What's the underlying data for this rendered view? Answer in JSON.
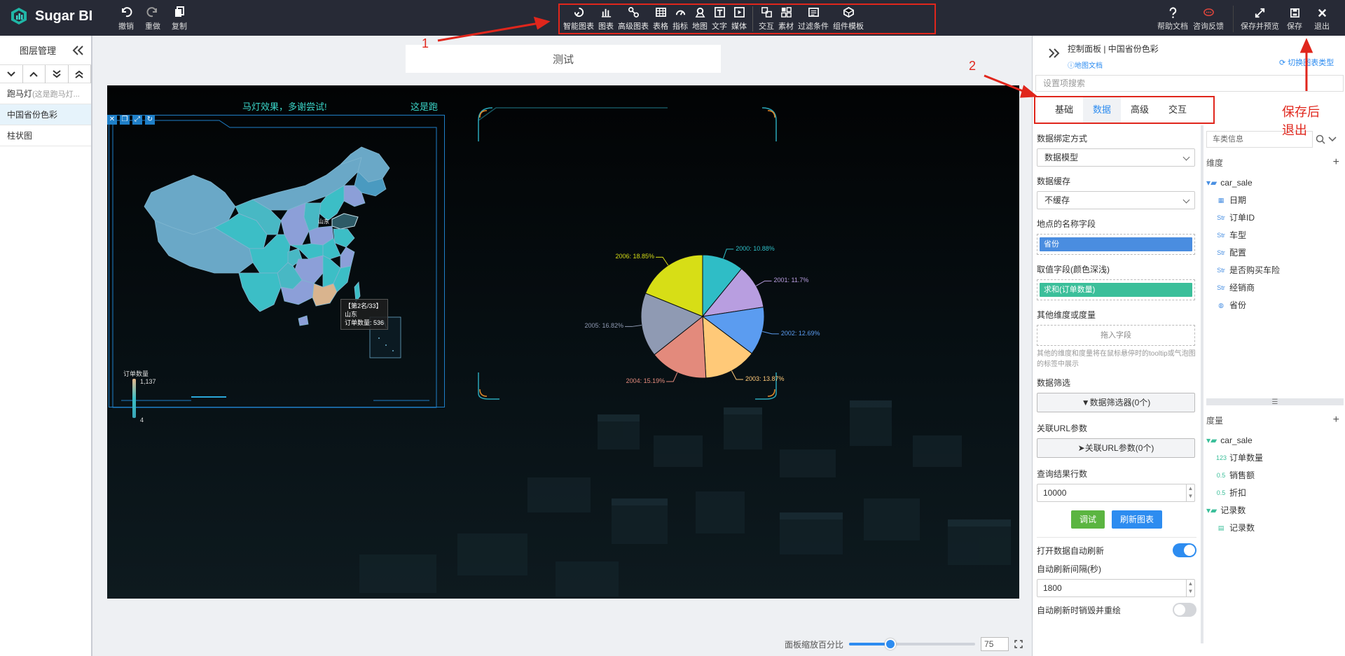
{
  "app": {
    "name": "Sugar BI"
  },
  "toolbar_left": [
    {
      "label": "撤销",
      "icon": "undo-icon"
    },
    {
      "label": "重做",
      "icon": "redo-icon"
    },
    {
      "label": "复制",
      "icon": "copy-icon"
    }
  ],
  "component_tools": [
    {
      "label": "智能图表",
      "icon": "smart-chart-icon"
    },
    {
      "label": "图表",
      "icon": "bar-chart-icon"
    },
    {
      "label": "高级图表",
      "icon": "advanced-chart-icon"
    },
    {
      "label": "表格",
      "icon": "table-icon"
    },
    {
      "label": "指标",
      "icon": "gauge-icon"
    },
    {
      "label": "地图",
      "icon": "map-pin-icon"
    },
    {
      "label": "文字",
      "icon": "text-icon"
    },
    {
      "label": "媒体",
      "icon": "media-icon"
    },
    {
      "label": "交互",
      "icon": "interaction-icon"
    },
    {
      "label": "素材",
      "icon": "material-icon"
    },
    {
      "label": "过滤条件",
      "icon": "filter-icon"
    },
    {
      "label": "组件模板",
      "icon": "template-icon"
    }
  ],
  "toolbar_right": [
    {
      "label": "帮助文档",
      "icon": "help-icon"
    },
    {
      "label": "咨询反馈",
      "icon": "feedback-icon"
    },
    {
      "label": "保存并预览",
      "icon": "expand-icon"
    },
    {
      "label": "保存",
      "icon": "save-icon"
    },
    {
      "label": "退出",
      "icon": "close-icon"
    }
  ],
  "layer_panel": {
    "title": "图层管理",
    "layers": [
      {
        "label": "跑马灯",
        "hint": "(这是跑马灯..."
      },
      {
        "label": "中国省份色彩",
        "hint": ""
      },
      {
        "label": "柱状图",
        "hint": ""
      }
    ]
  },
  "canvas": {
    "title": "测试",
    "marquee_1": "马灯效果，多谢尝试!",
    "marquee_2": "这是跑"
  },
  "map": {
    "tooltip": [
      "【第2名/33】",
      "山东",
      "订单数量: 536"
    ],
    "province_label": "山东",
    "legend_title": "订单数量",
    "legend_max": "1,137",
    "legend_min": "4"
  },
  "chart_data": {
    "type": "pie",
    "categories": [
      "2000",
      "2001",
      "2002",
      "2003",
      "2004",
      "2005",
      "2006"
    ],
    "values": [
      10.88,
      11.7,
      12.69,
      13.87,
      15.19,
      16.82,
      18.85
    ],
    "labels": [
      "2000: 10.88%",
      "2001: 11.7%",
      "2002: 12.69%",
      "2003: 13.87%",
      "2004: 15.19%",
      "2005: 16.82%",
      "2006: 18.85%"
    ],
    "colors": [
      "#2fbdc6",
      "#b89ee0",
      "#5b9cf0",
      "#ffc978",
      "#e38a7c",
      "#8f9ab3",
      "#d7de16"
    ]
  },
  "zoom": {
    "label": "面板缩放百分比",
    "value": "75",
    "fraction": 0.33
  },
  "right_panel": {
    "title": "控制面板 | 中国省份色彩",
    "doc_link": "地图文档",
    "switch_link": "切换图表类型",
    "search_placeholder": "设置项搜索",
    "tabs": [
      "基础",
      "数据",
      "高级",
      "交互"
    ],
    "active_tab": "数据",
    "form": {
      "binding_label": "数据绑定方式",
      "binding_value": "数据模型",
      "cache_label": "数据缓存",
      "cache_value": "不缓存",
      "location_label": "地点的名称字段",
      "location_chip": "省份",
      "value_label": "取值字段(颜色深浅)",
      "value_chip": "求和(订单数量)",
      "other_label": "其他维度或度量",
      "other_drop": "拖入字段",
      "other_note": "其他的维度和度量将在鼠标悬停时的tooltip或气泡图的标签中展示",
      "filter_label": "数据筛选",
      "filter_btn": "数据筛选器(0个)",
      "url_label": "关联URL参数",
      "url_btn": "关联URL参数(0个)",
      "rows_label": "查询结果行数",
      "rows_value": "10000",
      "debug_btn": "调试",
      "refresh_btn": "刷新图表",
      "auto_refresh_label": "打开数据自动刷新",
      "auto_refresh_on": true,
      "interval_label": "自动刷新间隔(秒)",
      "interval_value": "1800",
      "rerender_label": "自动刷新时销毁并重绘",
      "rerender_on": false
    },
    "fields": {
      "source": "车类信息",
      "dim_title": "维度",
      "dim_table": "car_sale",
      "dimensions": [
        {
          "label": "日期",
          "type": "date"
        },
        {
          "label": "订单ID",
          "type": "Str"
        },
        {
          "label": "车型",
          "type": "Str"
        },
        {
          "label": "配置",
          "type": "Str"
        },
        {
          "label": "是否购买车险",
          "type": "Str"
        },
        {
          "label": "经销商",
          "type": "Str"
        },
        {
          "label": "省份",
          "type": "geo"
        }
      ],
      "measure_title": "度量",
      "measure_table": "car_sale",
      "measures": [
        {
          "label": "订单数量",
          "type": "123"
        },
        {
          "label": "销售额",
          "type": "0.5"
        },
        {
          "label": "折扣",
          "type": "0.5"
        }
      ],
      "count_group": "记录数",
      "count_item": "记录数"
    }
  },
  "annotations": {
    "a1": "1",
    "a2": "2",
    "a3": "保存后",
    "a4": "退出"
  }
}
